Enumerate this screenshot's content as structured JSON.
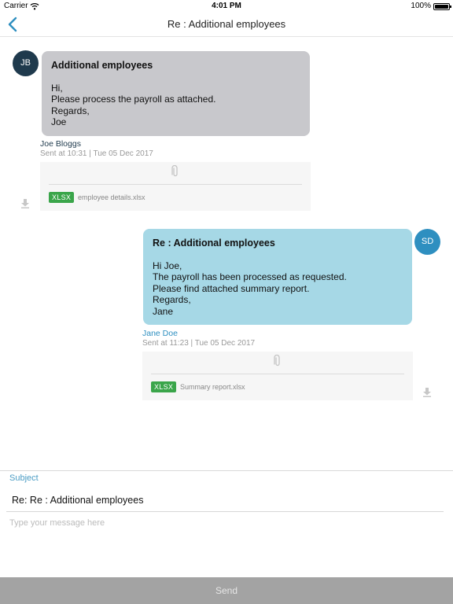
{
  "status_bar": {
    "carrier": "Carrier",
    "time": "4:01 PM",
    "battery": "100%",
    "battery_level": 1.0
  },
  "nav": {
    "title": "Re : Additional employees",
    "back_icon": "chevron-left-icon"
  },
  "colors": {
    "accent": "#2e8fc0",
    "received_bubble": "#c8c8cc",
    "sent_bubble": "#a6d8e6",
    "badge": "#3aa54a",
    "send_bar": "#a3a3a3"
  },
  "messages": [
    {
      "initials": "JB",
      "subject": "Additional employees",
      "body": [
        "Hi,",
        "Please process the payroll as attached.",
        "Regards,",
        "Joe"
      ],
      "sender": "Joe Bloggs",
      "sent_at": "Sent at 10:31 | Tue 05 Dec 2017",
      "attachment": {
        "type": "XLSX",
        "filename": "employee details.xlsx"
      }
    },
    {
      "initials": "SD",
      "subject": "Re : Additional employees",
      "body": [
        "Hi Joe,",
        "The payroll has been processed as requested.",
        "Please find attached summary report.",
        "Regards,",
        "Jane"
      ],
      "sender": "Jane Doe",
      "sent_at": "Sent at 11:23 | Tue 05 Dec 2017",
      "attachment": {
        "type": "XLSX",
        "filename": "Summary report.xlsx"
      }
    }
  ],
  "compose": {
    "subject_label": "Subject",
    "subject_value": "Re: Re : Additional employees",
    "message_placeholder": "Type your message here",
    "send_label": "Send"
  }
}
